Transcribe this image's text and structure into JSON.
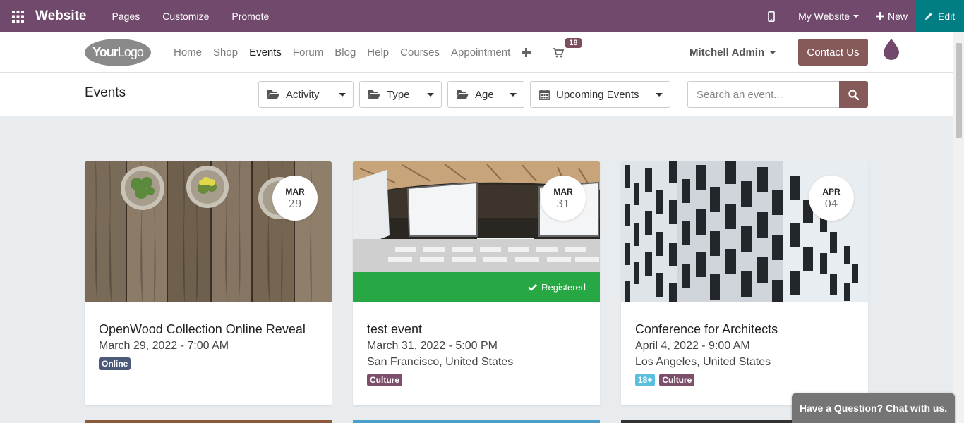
{
  "adminbar": {
    "brand": "Website",
    "links": [
      "Pages",
      "Customize",
      "Promote"
    ],
    "site_selector": "My Website",
    "new_label": "New",
    "edit_label": "Edit"
  },
  "header": {
    "logo_text_bold": "Your",
    "logo_text": "Logo",
    "nav": [
      "Home",
      "Shop",
      "Events",
      "Forum",
      "Blog",
      "Help",
      "Courses",
      "Appointment"
    ],
    "active_nav": "Events",
    "cart_count": "18",
    "user_name": "Mitchell Admin",
    "contact_label": "Contact Us"
  },
  "filters": {
    "page_title": "Events",
    "activity": "Activity",
    "type": "Type",
    "age": "Age",
    "date_filter": "Upcoming Events",
    "search_placeholder": "Search an event..."
  },
  "events": [
    {
      "month": "MAR",
      "day": "29",
      "title": "OpenWood Collection Online Reveal",
      "datetime": "March 29, 2022 - 7:00 AM",
      "location": "",
      "tags": [
        {
          "label": "Online",
          "color": "#4c5a7a"
        }
      ]
    },
    {
      "month": "MAR",
      "day": "31",
      "title": "test event",
      "datetime": "March 31, 2022 - 5:00 PM",
      "location": "San Francisco, United States",
      "registered": "Registered",
      "tags": [
        {
          "label": "Culture",
          "color": "#7c4f6a"
        }
      ]
    },
    {
      "month": "APR",
      "day": "04",
      "title": "Conference for Architects",
      "datetime": "April 4, 2022 - 9:00 AM",
      "location": "Los Angeles, United States",
      "tags": [
        {
          "label": "18+",
          "color": "#5bc0de"
        },
        {
          "label": "Culture",
          "color": "#7c4f6a"
        }
      ]
    }
  ],
  "chat_label": "Have a Question? Chat with us.",
  "colors": {
    "admin_bar": "#71496c",
    "edit_bg": "#017e84",
    "primary": "#875a5a",
    "registered": "#28a745"
  }
}
